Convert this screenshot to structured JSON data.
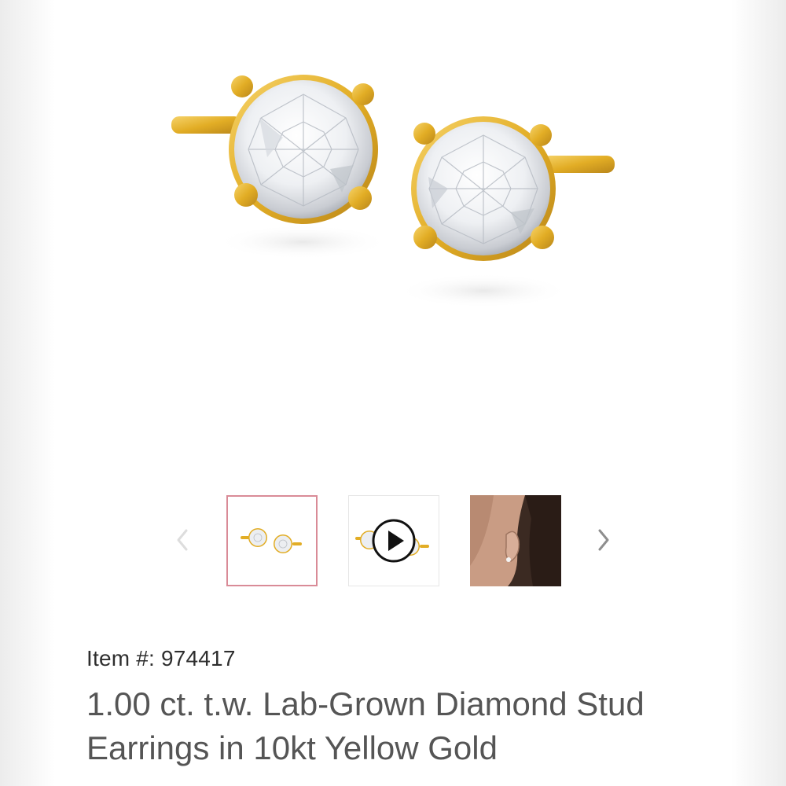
{
  "gallery": {
    "main_image_alt": "lab-grown diamond stud earrings",
    "thumbnails": [
      {
        "icon": "earrings-thumbnail",
        "selected": true
      },
      {
        "icon": "video-play-icon",
        "selected": false
      },
      {
        "icon": "model-ear-thumbnail",
        "selected": false
      }
    ],
    "prev_icon": "chevron-left-icon",
    "next_icon": "chevron-right-icon"
  },
  "product": {
    "item_number": "Item #: 974417",
    "title": "1.00 ct. t.w. Lab-Grown Diamond Stud Earrings in 10kt Yellow Gold"
  },
  "colors": {
    "selected_border": "#d98b97",
    "gold": "#e8b52e",
    "text_dark": "#2e2e2e",
    "text_title": "#555555"
  }
}
